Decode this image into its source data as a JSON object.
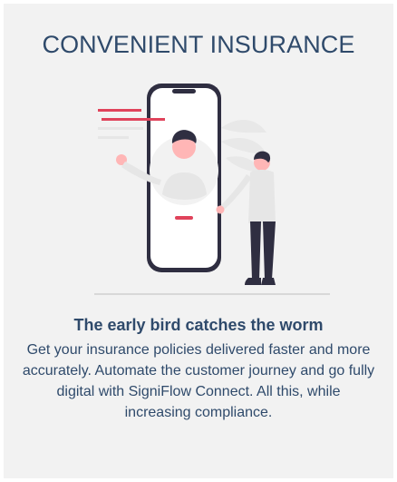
{
  "card": {
    "title": "CONVENIENT INSURANCE",
    "illustration_name": "person-with-phone-illustration",
    "subtitle": "The early bird catches the worm",
    "description": "Get your insurance policies delivered faster and more accurately. Automate the customer journey and go fully digital with SigniFlow Connect. All this, while increasing compliance."
  },
  "colors": {
    "background": "#f2f2f2",
    "text": "#2f4a6b",
    "accent": "#e0435b",
    "phone_frame": "#2f2e41"
  }
}
